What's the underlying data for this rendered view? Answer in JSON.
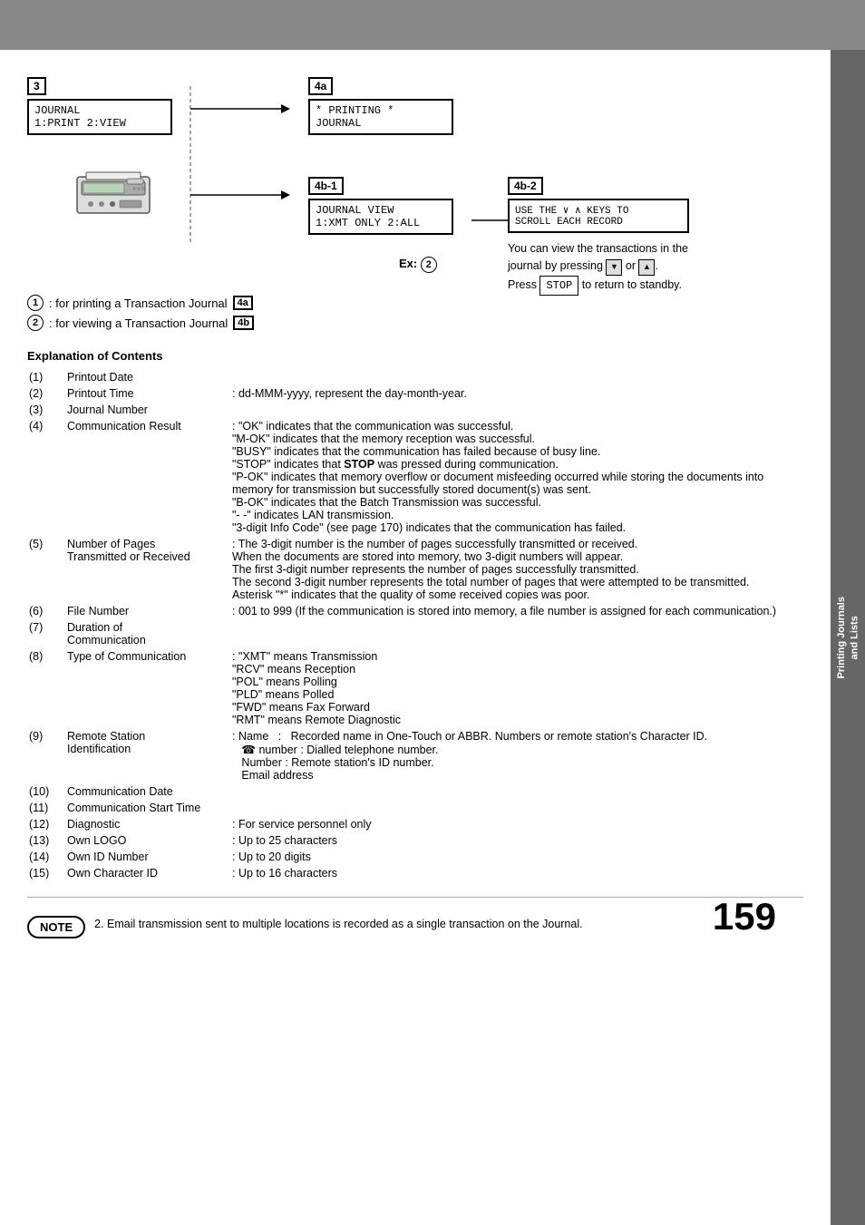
{
  "page": {
    "number": "159",
    "sidebar_label": "Printing Journals\nand Lists"
  },
  "steps": {
    "step3": {
      "label": "3",
      "screen_line1": "JOURNAL",
      "screen_line2": "1:PRINT 2:VIEW"
    },
    "step4a": {
      "label": "4a",
      "screen_line1": "* PRINTING *",
      "screen_line2": "JOURNAL"
    },
    "step4b1": {
      "label": "4b-1",
      "screen_line1": "JOURNAL VIEW",
      "screen_line2": "1:XMT ONLY 2:ALL"
    },
    "step4b2": {
      "label": "4b-2",
      "screen_line1": "USE THE ∨ ∧ KEYS TO",
      "screen_line2": "SCROLL EACH RECORD"
    }
  },
  "legend": {
    "item1": ": for printing a Transaction Journal",
    "item2": ": for viewing a Transaction Journal",
    "item1_ref": "4a",
    "item2_ref": "4b",
    "view_text": "You can view the transactions in the journal by pressing",
    "press_stop": "Press",
    "stop_label": "STOP",
    "return_text": "to return to standby."
  },
  "explanation": {
    "title": "Explanation of Contents",
    "items": [
      {
        "num": "(1)",
        "label": "Printout Date",
        "desc": ""
      },
      {
        "num": "(2)",
        "label": "Printout Time",
        "desc": ": dd-MMM-yyyy, represent the day-month-year."
      },
      {
        "num": "(3)",
        "label": "Journal Number",
        "desc": ""
      },
      {
        "num": "(4)",
        "label": "Communication Result",
        "desc": ": \"OK\" indicates that the communication was successful.\n\"M-OK\" indicates that the memory reception was successful.\n\"BUSY\" indicates that the communication has failed because of busy line.\n\"STOP\" indicates that STOP was pressed during communication.\n\"P-OK\" indicates that memory overflow or document misfeeding occurred while storing the documents into memory for transmission but successfully stored document(s) was sent.\n\"B-OK\" indicates that the Batch Transmission was successful.\n\"- -\" indicates LAN transmission.\n\"3-digit Info Code\" (see page 170) indicates that the communication has failed."
      },
      {
        "num": "(5)",
        "label": "Number of Pages\nTransmitted or Received",
        "desc": ": The 3-digit number is the number of pages successfully transmitted or received.\nWhen the documents are stored into memory, two 3-digit numbers will appear.\nThe first 3-digit number represents the number of pages successfully transmitted.\nThe second 3-digit number represents the total number of pages that were attempted to be transmitted.\nAsterisk \"*\" indicates that the quality of some received copies was poor."
      },
      {
        "num": "(6)",
        "label": "File Number",
        "desc": ": 001 to 999 (If the communication is stored into memory, a file number is assigned for each communication.)"
      },
      {
        "num": "(7)",
        "label": "Duration of\nCommunication",
        "desc": ""
      },
      {
        "num": "(8)",
        "label": "Type of Communication",
        "desc": ": \"XMT\" means Transmission\n\"RCV\" means Reception\n\"POL\" means Polling\n\"PLD\" means Polled\n\"FWD\" means Fax Forward\n\"RMT\" means Remote Diagnostic"
      },
      {
        "num": "(9)",
        "label": "Remote Station\nIdentification",
        "desc": ": Name   :  Recorded name in One-Touch or ABBR. Numbers or remote station's Character ID.\n☎ number : Dialled telephone number.\nNumber : Remote station's ID number.\nEmail address"
      },
      {
        "num": "(10)",
        "label": "Communication Date",
        "desc": ""
      },
      {
        "num": "(11)",
        "label": "Communication Start Time",
        "desc": ""
      },
      {
        "num": "(12)",
        "label": "Diagnostic",
        "desc": ": For service personnel only"
      },
      {
        "num": "(13)",
        "label": "Own LOGO",
        "desc": ": Up to 25 characters"
      },
      {
        "num": "(14)",
        "label": "Own ID Number",
        "desc": ": Up to 20 digits"
      },
      {
        "num": "(15)",
        "label": "Own Character ID",
        "desc": ": Up to 16 characters"
      }
    ]
  },
  "note": {
    "label": "NOTE",
    "text": "2. Email transmission sent to multiple locations is recorded as a single transaction on the Journal."
  }
}
